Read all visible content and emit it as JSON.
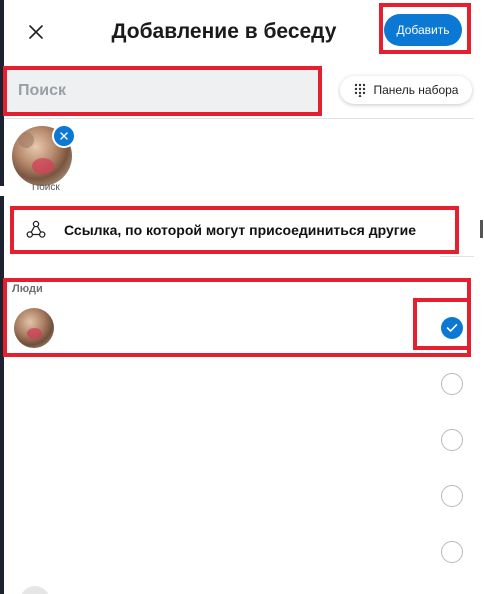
{
  "header": {
    "title": "Добавление в беседу",
    "add_label": "Добавить",
    "close_icon": "close-icon"
  },
  "search": {
    "placeholder": "Поиск",
    "value": ""
  },
  "dialpad": {
    "label": "Панель набора",
    "icon": "dialpad-icon"
  },
  "selected": {
    "avatar_icon": "avatar",
    "remove_icon": "remove-icon"
  },
  "share_link": {
    "label": "Ссылка, по которой могут присоединиться другие",
    "icon": "share-link-icon"
  },
  "people": {
    "section_label": "Люди",
    "rows": [
      {
        "checked": true
      },
      {
        "checked": false
      },
      {
        "checked": false
      },
      {
        "checked": false
      },
      {
        "checked": false
      }
    ]
  },
  "colors": {
    "accent": "#0b78d4",
    "annotation": "#e5202e"
  }
}
